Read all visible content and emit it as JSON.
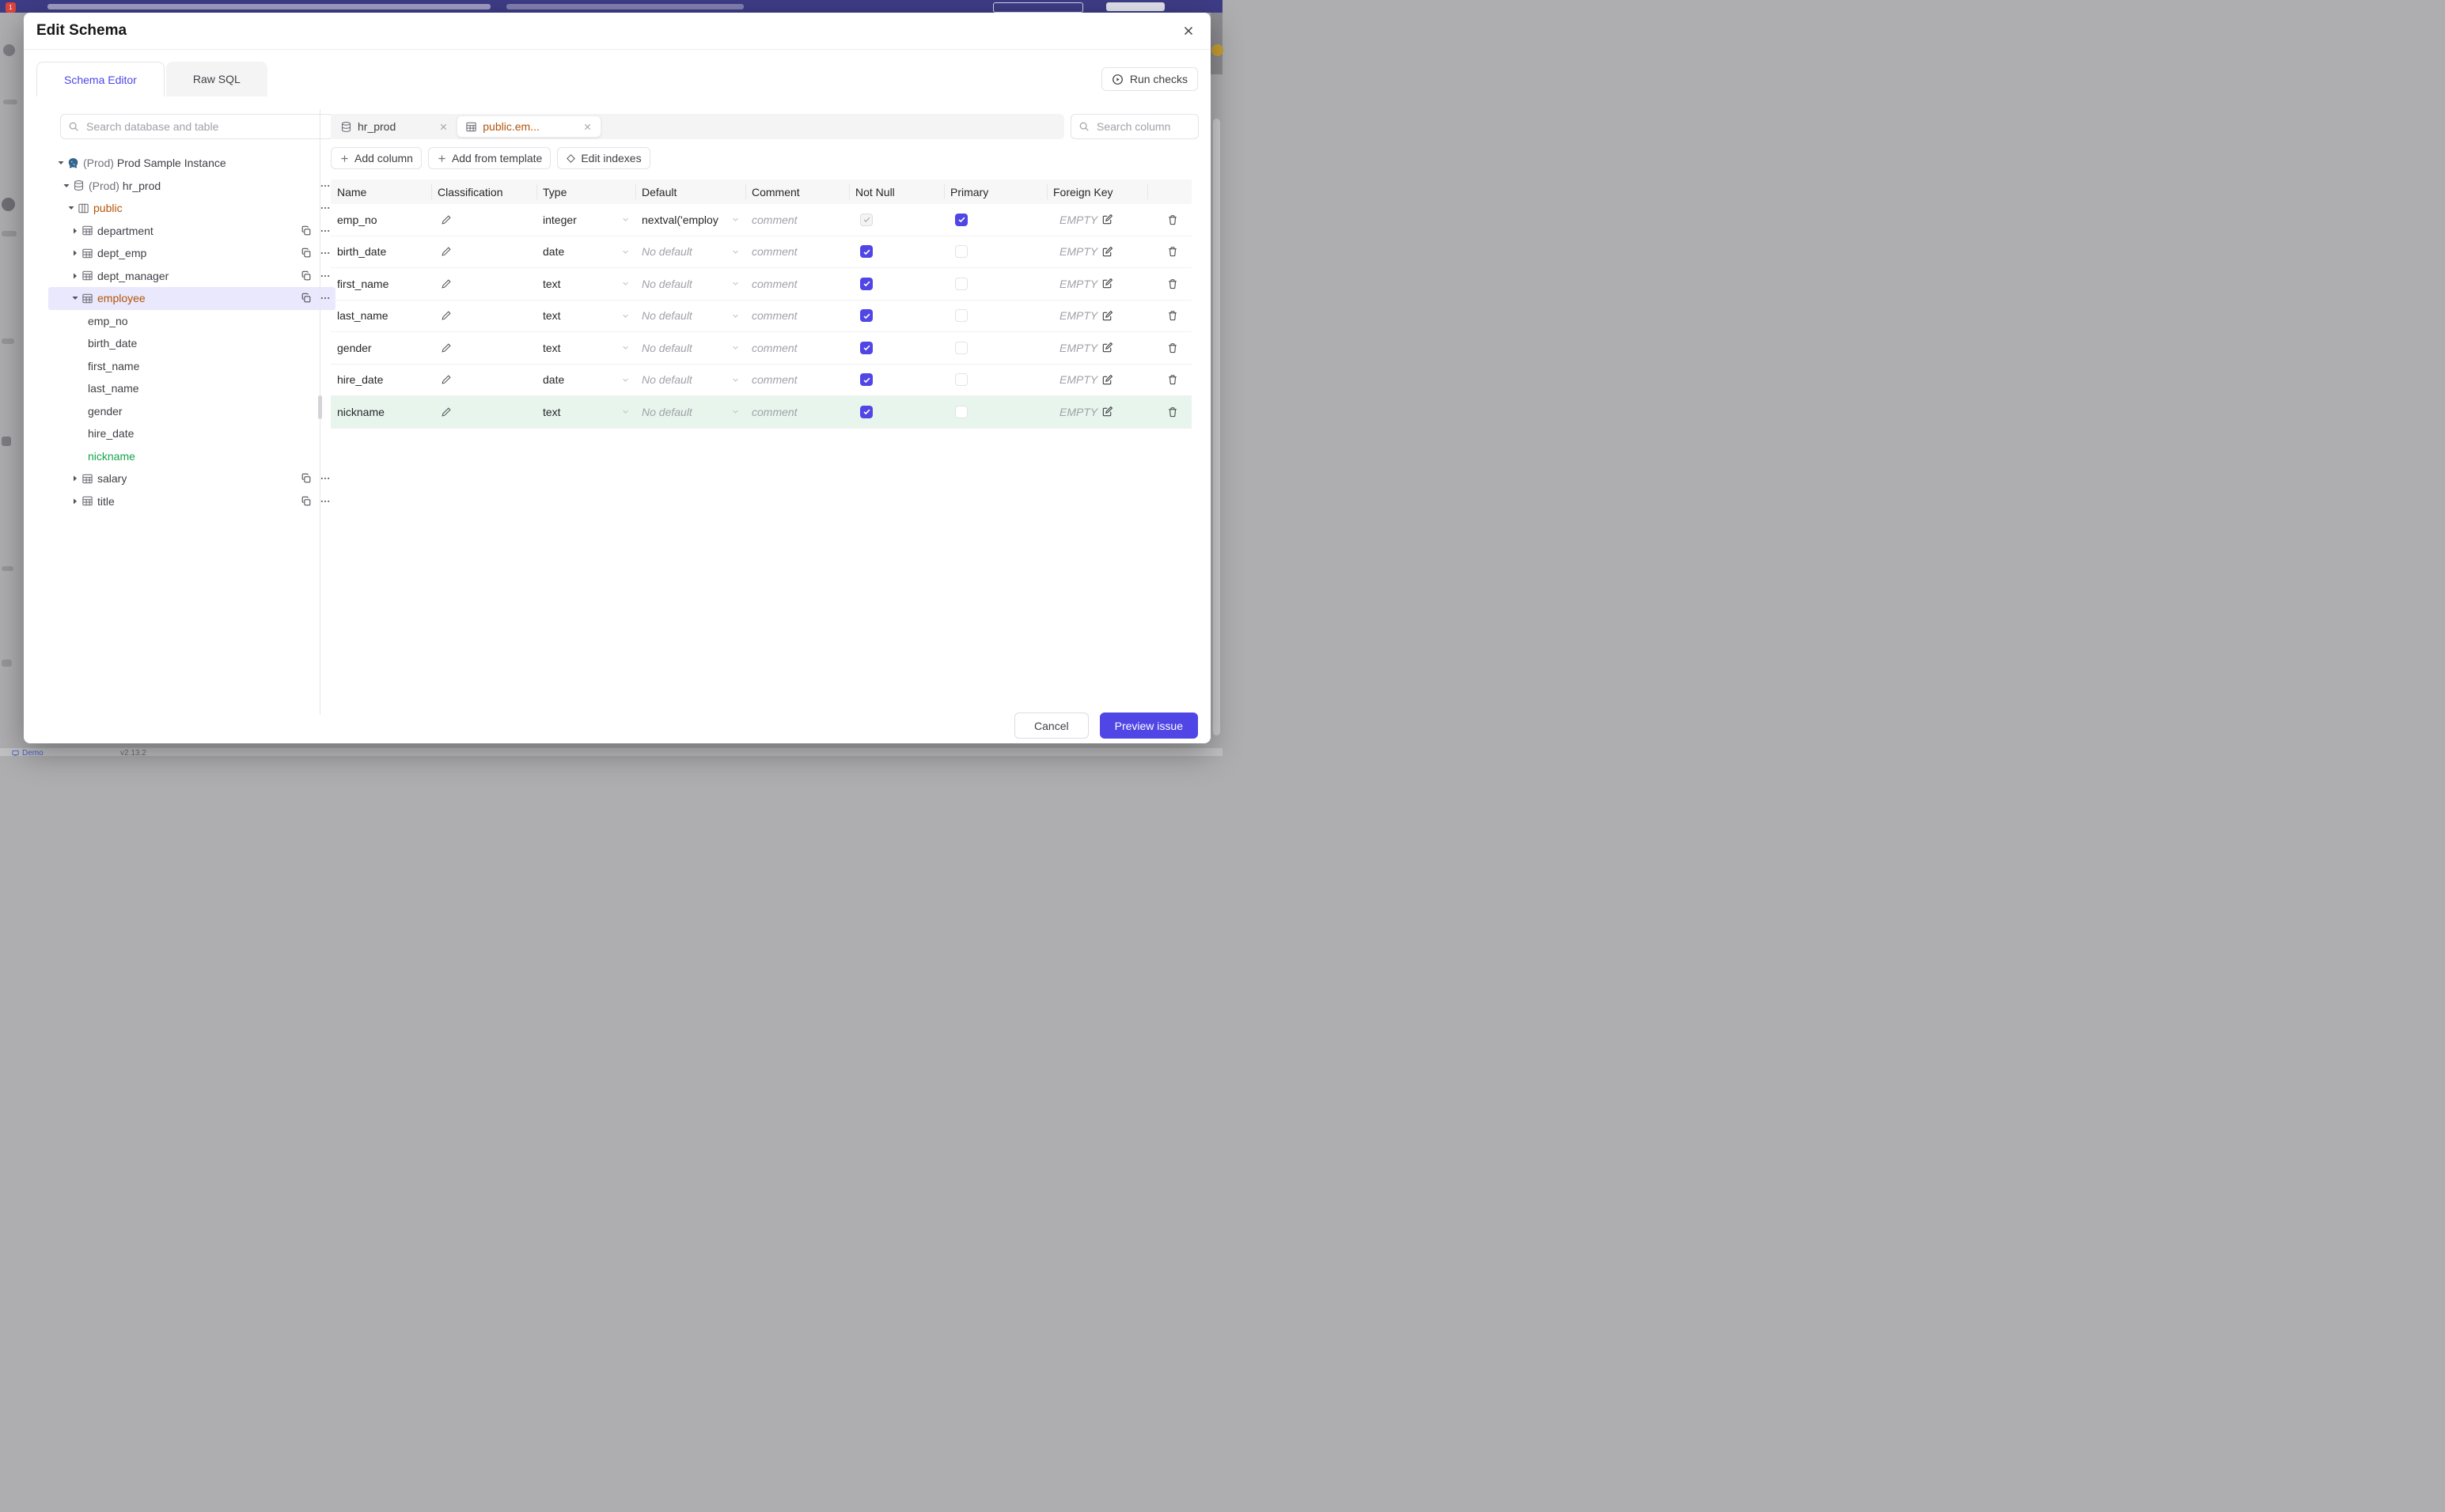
{
  "modal": {
    "title": "Edit Schema"
  },
  "view_tabs": [
    {
      "label": "Schema Editor",
      "active": true
    },
    {
      "label": "Raw SQL",
      "active": false
    }
  ],
  "run_checks": {
    "label": "Run checks",
    "icon": "play-circle-icon"
  },
  "sidebar": {
    "search_placeholder": "Search database and table",
    "tree": [
      {
        "level": 0,
        "caret": "down",
        "icon": "postgres-icon",
        "prefix": "(Prod)",
        "label": "Prod Sample Instance",
        "state": "default",
        "actions": []
      },
      {
        "level": 1,
        "caret": "down",
        "icon": "database-icon",
        "prefix": "(Prod)",
        "label": "hr_prod",
        "state": "default",
        "actions": [
          "more"
        ]
      },
      {
        "level": 2,
        "caret": "down",
        "icon": "schema-icon",
        "prefix": "",
        "label": "public",
        "state": "modified",
        "actions": [
          "more"
        ]
      },
      {
        "level": 3,
        "caret": "right",
        "icon": "table-icon",
        "prefix": "",
        "label": "department",
        "state": "default",
        "actions": [
          "copy",
          "more"
        ]
      },
      {
        "level": 3,
        "caret": "right",
        "icon": "table-icon",
        "prefix": "",
        "label": "dept_emp",
        "state": "default",
        "actions": [
          "copy",
          "more"
        ]
      },
      {
        "level": 3,
        "caret": "right",
        "icon": "table-icon",
        "prefix": "",
        "label": "dept_manager",
        "state": "default",
        "actions": [
          "copy",
          "more"
        ]
      },
      {
        "level": 3,
        "caret": "down",
        "icon": "table-icon",
        "prefix": "",
        "label": "employee",
        "state": "modified",
        "selected": true,
        "actions": [
          "copy",
          "more"
        ]
      },
      {
        "level": 4,
        "caret": null,
        "icon": null,
        "prefix": "",
        "label": "emp_no",
        "state": "default",
        "actions": []
      },
      {
        "level": 4,
        "caret": null,
        "icon": null,
        "prefix": "",
        "label": "birth_date",
        "state": "default",
        "actions": []
      },
      {
        "level": 4,
        "caret": null,
        "icon": null,
        "prefix": "",
        "label": "first_name",
        "state": "default",
        "actions": []
      },
      {
        "level": 4,
        "caret": null,
        "icon": null,
        "prefix": "",
        "label": "last_name",
        "state": "default",
        "actions": []
      },
      {
        "level": 4,
        "caret": null,
        "icon": null,
        "prefix": "",
        "label": "gender",
        "state": "default",
        "actions": []
      },
      {
        "level": 4,
        "caret": null,
        "icon": null,
        "prefix": "",
        "label": "hire_date",
        "state": "default",
        "actions": []
      },
      {
        "level": 4,
        "caret": null,
        "icon": null,
        "prefix": "",
        "label": "nickname",
        "state": "added",
        "actions": []
      },
      {
        "level": 3,
        "caret": "right",
        "icon": "table-icon",
        "prefix": "",
        "label": "salary",
        "state": "default",
        "actions": [
          "copy",
          "more"
        ]
      },
      {
        "level": 3,
        "caret": "right",
        "icon": "table-icon",
        "prefix": "",
        "label": "title",
        "state": "default",
        "actions": [
          "copy",
          "more"
        ]
      }
    ]
  },
  "editor": {
    "open_tabs": [
      {
        "icon": "database-icon",
        "label": "hr_prod",
        "active": false
      },
      {
        "icon": "table-icon",
        "label": "public.em...",
        "active": true,
        "modified": true
      }
    ],
    "toolbar": [
      {
        "icon": "plus-icon",
        "label": "Add column"
      },
      {
        "icon": "plus-icon",
        "label": "Add from template"
      },
      {
        "icon": "diamond-icon",
        "label": "Edit indexes"
      }
    ],
    "column_search_placeholder": "Search column",
    "table": {
      "headers": [
        "Name",
        "Classification",
        "Type",
        "Default",
        "Comment",
        "Not Null",
        "Primary",
        "Foreign Key",
        ""
      ],
      "comment_placeholder": "comment",
      "no_default_placeholder": "No default",
      "foreign_key_empty": "EMPTY",
      "rows": [
        {
          "name": "emp_no",
          "type": "integer",
          "default": "nextval('employ",
          "default_is_placeholder": false,
          "not_null": "checked-disabled",
          "primary": true,
          "added": false
        },
        {
          "name": "birth_date",
          "type": "date",
          "default": "No default",
          "default_is_placeholder": true,
          "not_null": "checked",
          "primary": false,
          "added": false
        },
        {
          "name": "first_name",
          "type": "text",
          "default": "No default",
          "default_is_placeholder": true,
          "not_null": "checked",
          "primary": false,
          "added": false
        },
        {
          "name": "last_name",
          "type": "text",
          "default": "No default",
          "default_is_placeholder": true,
          "not_null": "checked",
          "primary": false,
          "added": false
        },
        {
          "name": "gender",
          "type": "text",
          "default": "No default",
          "default_is_placeholder": true,
          "not_null": "checked",
          "primary": false,
          "added": false
        },
        {
          "name": "hire_date",
          "type": "date",
          "default": "No default",
          "default_is_placeholder": true,
          "not_null": "checked",
          "primary": false,
          "added": false
        },
        {
          "name": "nickname",
          "type": "text",
          "default": "No default",
          "default_is_placeholder": true,
          "not_null": "checked",
          "primary": false,
          "added": true
        }
      ]
    }
  },
  "footer": {
    "cancel": "Cancel",
    "primary": "Preview issue"
  },
  "background_page": {
    "brand": "Demo",
    "version": "v2.13.2"
  },
  "colors": {
    "accent": "#4f46e5",
    "modified_text": "#b45309",
    "added_text": "#16a34a",
    "added_row_bg": "#e7f5ec",
    "selected_tree_bg": "#e9e8fc",
    "topbar_bg": "#3e3c86"
  }
}
